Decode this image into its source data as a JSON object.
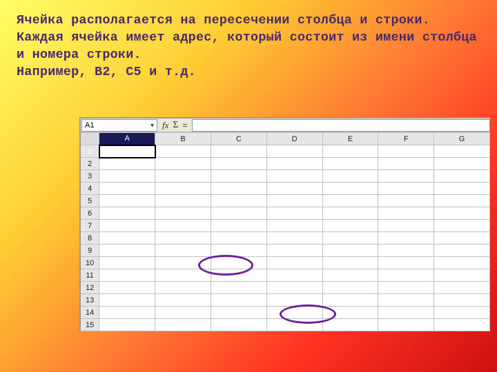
{
  "description": {
    "line1": "Ячейка располагается на пересечении столбца и строки.",
    "line2": "Каждая ячейка имеет адрес, который состоит из имени столбца и номера строки.",
    "line3": "Например, В2, С5 и т.д."
  },
  "formula_bar": {
    "name_box_value": "A1",
    "fx": "fx",
    "sigma": "Σ",
    "eq": "=",
    "input_value": ""
  },
  "columns": [
    "A",
    "B",
    "C",
    "D",
    "E",
    "F",
    "G"
  ],
  "rows": [
    "1",
    "2",
    "3",
    "4",
    "5",
    "6",
    "7",
    "8",
    "9",
    "10",
    "11",
    "12",
    "13",
    "14",
    "15"
  ],
  "active_cell": {
    "col": 0,
    "row": 0
  },
  "selected_col": 0,
  "selected_row": 0
}
